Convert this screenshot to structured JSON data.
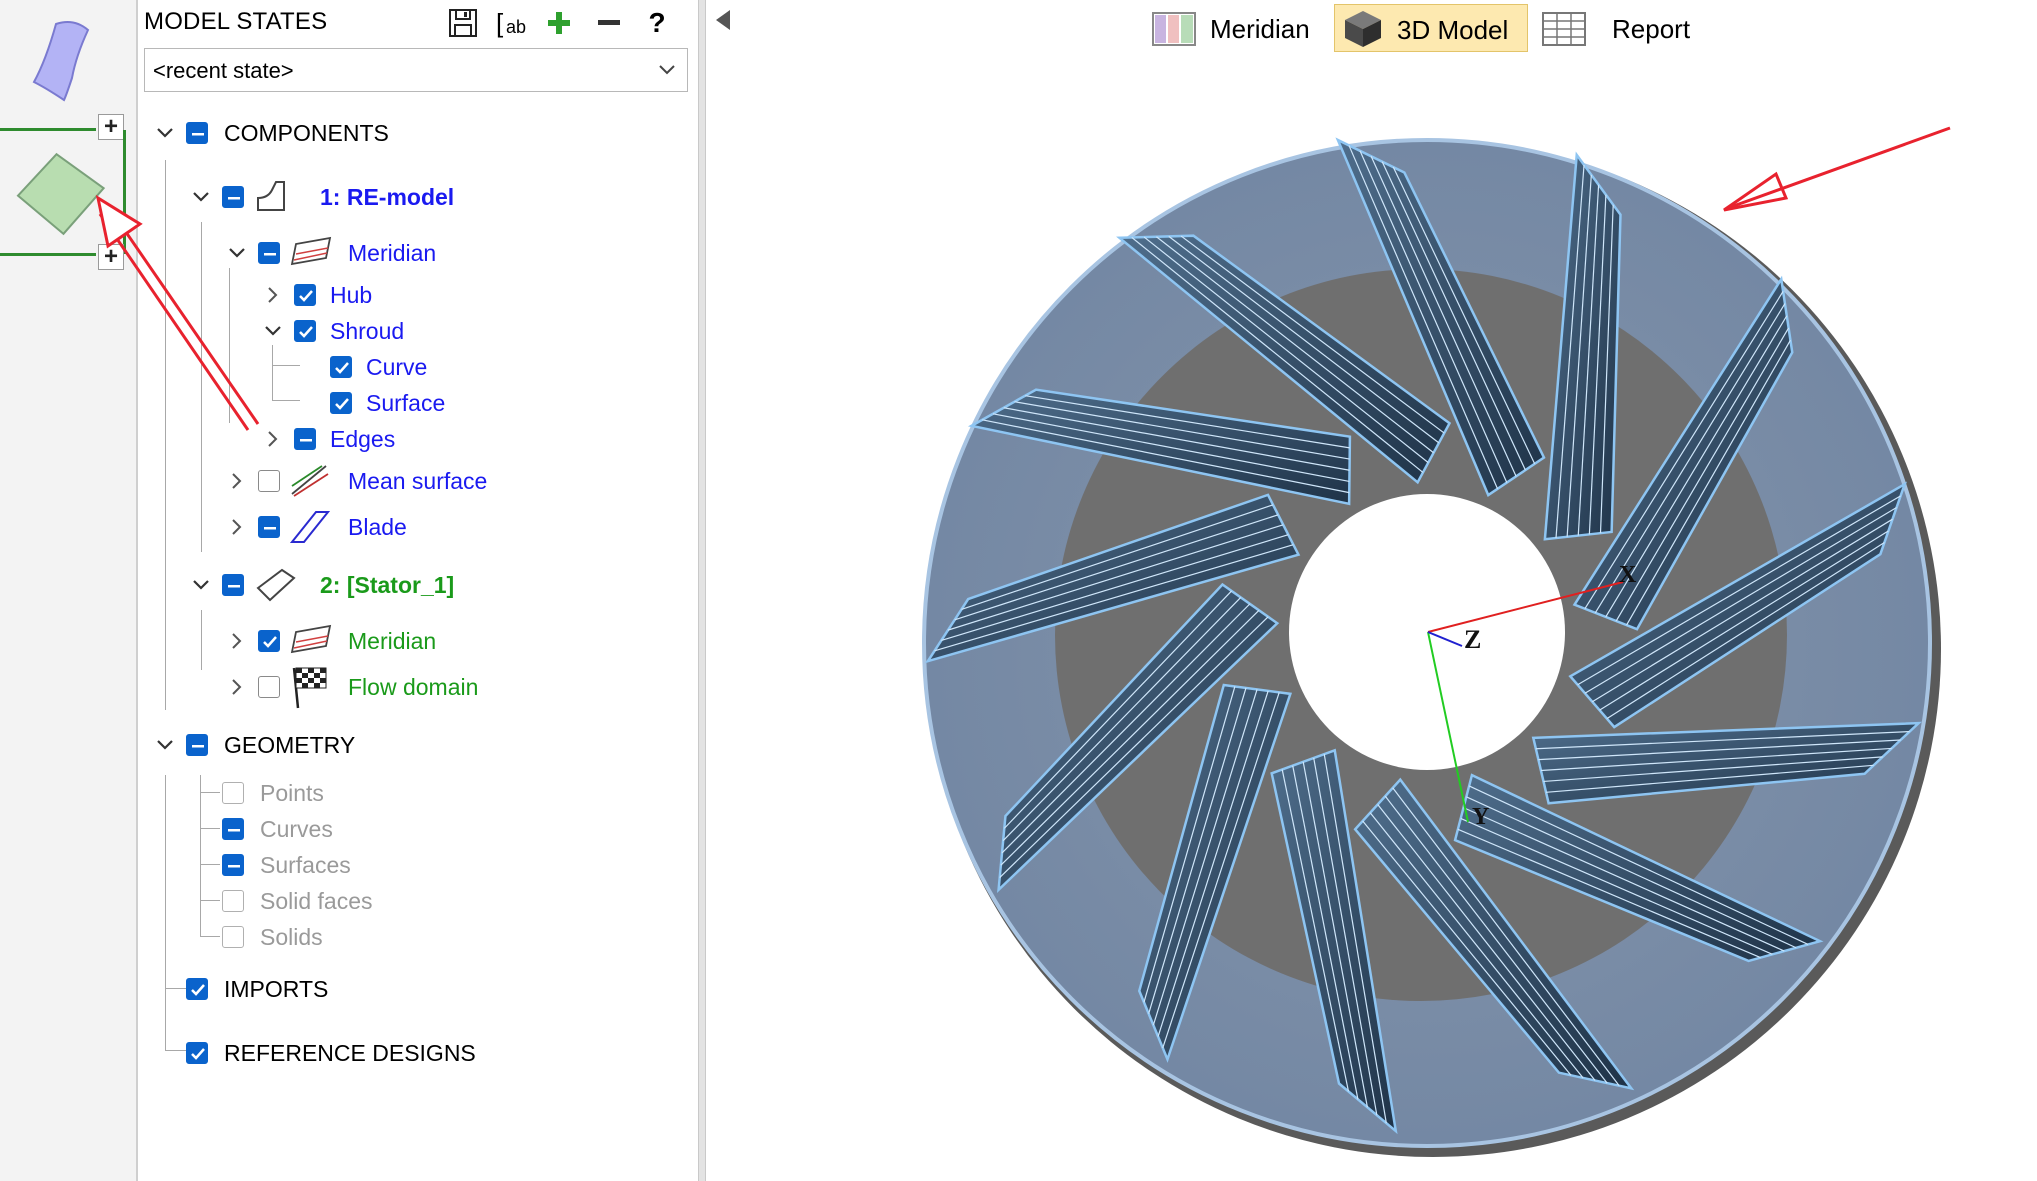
{
  "panel": {
    "title": "MODEL STATES",
    "toolbar": {
      "save_icon": "save-icon",
      "rename_label": "ab",
      "add_icon": "plus-icon",
      "remove_icon": "minus-icon",
      "help_label": "?"
    },
    "state_select": {
      "value": "<recent state>"
    }
  },
  "tree": {
    "components": "COMPONENTS",
    "re_model": "1: RE-model",
    "meridian": "Meridian",
    "hub": "Hub",
    "shroud": "Shroud",
    "curve": "Curve",
    "surface": "Surface",
    "edges": "Edges",
    "mean_surface": "Mean surface",
    "blade": "Blade",
    "stator": "2: [Stator_1]",
    "stator_meridian": "Meridian",
    "flow_domain": "Flow domain",
    "geometry": "GEOMETRY",
    "points": "Points",
    "curves": "Curves",
    "surfaces": "Surfaces",
    "solid_faces": "Solid faces",
    "solids": "Solids",
    "imports": "IMPORTS",
    "reference_designs": "REFERENCE DESIGNS"
  },
  "view_tabs": {
    "meridian": "Meridian",
    "model3d": "3D Model",
    "report": "Report",
    "active": "3D Model"
  },
  "axes": {
    "x": "X",
    "y": "Y",
    "z": "Z"
  },
  "colors": {
    "checkbox": "#0a63cc",
    "component_blue": "#1a1af0",
    "stator_green": "#1a9a1a",
    "active_tab": "#fde9b0",
    "annotation_arrow": "#e8222e",
    "blade_edge": "#8ec5f2"
  }
}
